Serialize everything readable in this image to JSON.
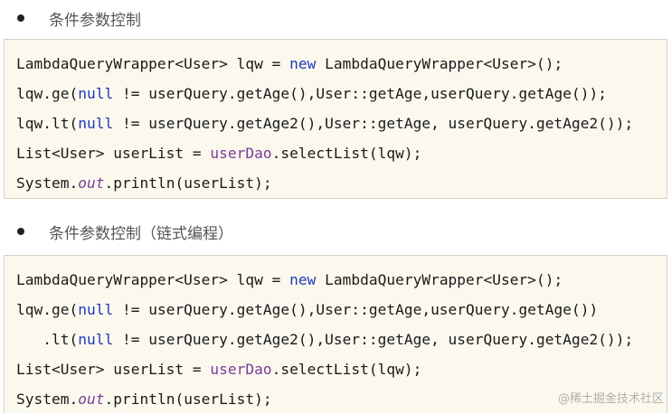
{
  "section1": {
    "heading": "条件参数控制",
    "lines": [
      [
        {
          "t": "LambdaQueryWrapper<User> lqw = ",
          "c": ""
        },
        {
          "t": "new",
          "c": "kw"
        },
        {
          "t": " LambdaQueryWrapper<User>();",
          "c": ""
        }
      ],
      [
        {
          "t": "lqw.ge(",
          "c": ""
        },
        {
          "t": "null",
          "c": "kw"
        },
        {
          "t": " != userQuery.getAge(),User::getAge,userQuery.getAge());",
          "c": ""
        }
      ],
      [
        {
          "t": "lqw.lt(",
          "c": ""
        },
        {
          "t": "null",
          "c": "kw"
        },
        {
          "t": " != userQuery.getAge2(),User::getAge, userQuery.getAge2());",
          "c": ""
        }
      ],
      [
        {
          "t": "List<User> userList = ",
          "c": ""
        },
        {
          "t": "userDao",
          "c": "fld"
        },
        {
          "t": ".selectList(lqw);",
          "c": ""
        }
      ],
      [
        {
          "t": "System.",
          "c": ""
        },
        {
          "t": "out",
          "c": "it"
        },
        {
          "t": ".println(userList);",
          "c": ""
        }
      ]
    ]
  },
  "section2": {
    "heading": "条件参数控制（链式编程）",
    "lines": [
      [
        {
          "t": "LambdaQueryWrapper<User> lqw = ",
          "c": ""
        },
        {
          "t": "new",
          "c": "kw"
        },
        {
          "t": " LambdaQueryWrapper<User>();",
          "c": ""
        }
      ],
      [
        {
          "t": "lqw.ge(",
          "c": ""
        },
        {
          "t": "null",
          "c": "kw"
        },
        {
          "t": " != userQuery.getAge(),User::getAge,userQuery.getAge())",
          "c": ""
        }
      ],
      [
        {
          "t": "   .lt(",
          "c": ""
        },
        {
          "t": "null",
          "c": "kw"
        },
        {
          "t": " != userQuery.getAge2(),User::getAge, userQuery.getAge2());",
          "c": ""
        }
      ],
      [
        {
          "t": "List<User> userList = ",
          "c": ""
        },
        {
          "t": "userDao",
          "c": "fld"
        },
        {
          "t": ".selectList(lqw);",
          "c": ""
        }
      ],
      [
        {
          "t": "System.",
          "c": ""
        },
        {
          "t": "out",
          "c": "it"
        },
        {
          "t": ".println(userList);",
          "c": ""
        }
      ]
    ]
  },
  "watermark": "@稀土掘金技术社区"
}
